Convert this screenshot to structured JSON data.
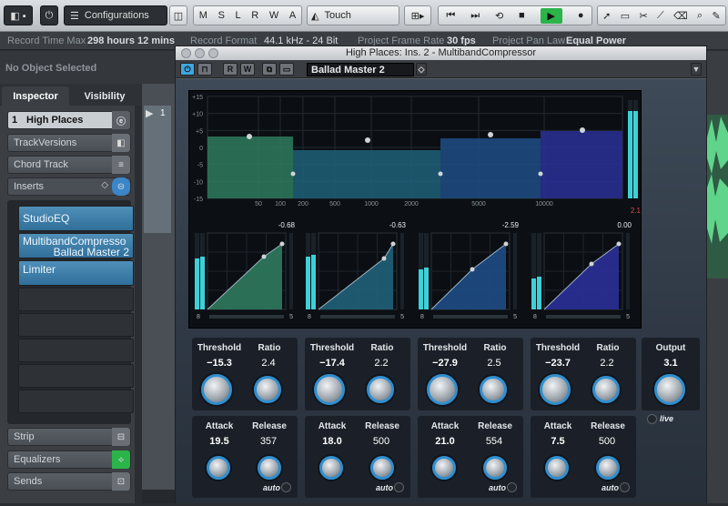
{
  "toolbar": {
    "configurations": "Configurations",
    "m": "M",
    "s": "S",
    "l": "L",
    "r": "R",
    "w": "W",
    "a": "A",
    "automation_mode": "Touch"
  },
  "infobar": {
    "rec_time_label": "Record Time Max",
    "rec_time_value": "298 hours 12 mins",
    "rec_format_label": "Record Format",
    "rec_format_value": "44.1 kHz - 24 Bit",
    "frame_rate_label": "Project Frame Rate",
    "frame_rate_value": "30 fps",
    "pan_law_label": "Project Pan Law",
    "pan_law_value": "Equal Power"
  },
  "left": {
    "no_object": "No Object Selected",
    "tab_inspector": "Inspector",
    "tab_visibility": "Visibility",
    "track_num": "1",
    "track_name": "High Places",
    "track_versions": "TrackVersions",
    "chord_track": "Chord Track",
    "inserts": "Inserts",
    "slot1": "StudioEQ",
    "slot2_line1": "MultibandCompresso",
    "slot2_line2": "Ballad Master 2",
    "slot3": "Limiter",
    "strip": "Strip",
    "equalizers": "Equalizers",
    "sends": "Sends"
  },
  "plugin": {
    "title": "High Places: Ins. 2 - MultibandCompressor",
    "preset": "Ballad Master 2",
    "db_scale": [
      "+15",
      "+10",
      "+5",
      "0",
      "-5",
      "-10",
      "-15"
    ],
    "freq_labels": [
      "50",
      "100",
      "200",
      "500",
      "1000",
      "2000",
      "5000",
      "10000"
    ],
    "meter_peak": "2.1",
    "band_peaks": [
      "-0.68",
      "-0.63",
      "-2.59",
      "0.00"
    ],
    "band_scale_left": "8",
    "band_scale_right": "5",
    "bands": [
      {
        "threshold_label": "Threshold",
        "ratio_label": "Ratio",
        "attack_label": "Attack",
        "release_label": "Release",
        "threshold": "−15.3",
        "ratio": "2.4",
        "attack": "19.5",
        "release": "357",
        "auto": "auto"
      },
      {
        "threshold_label": "Threshold",
        "ratio_label": "Ratio",
        "attack_label": "Attack",
        "release_label": "Release",
        "threshold": "−17.4",
        "ratio": "2.2",
        "attack": "18.0",
        "release": "500",
        "auto": "auto"
      },
      {
        "threshold_label": "Threshold",
        "ratio_label": "Ratio",
        "attack_label": "Attack",
        "release_label": "Release",
        "threshold": "−27.9",
        "ratio": "2.5",
        "attack": "21.0",
        "release": "554",
        "auto": "auto"
      },
      {
        "threshold_label": "Threshold",
        "ratio_label": "Ratio",
        "attack_label": "Attack",
        "release_label": "Release",
        "threshold": "−23.7",
        "ratio": "2.2",
        "attack": "7.5",
        "release": "500",
        "auto": "auto"
      }
    ],
    "output_label": "Output",
    "output": "3.1",
    "live": "live"
  },
  "colors": {
    "accent": "#3fa7e0",
    "green": "#2bb44a",
    "band1": "#2e7a5e",
    "band2": "#1f6079",
    "band3": "#1e4c86",
    "band4": "#2a2f98"
  }
}
